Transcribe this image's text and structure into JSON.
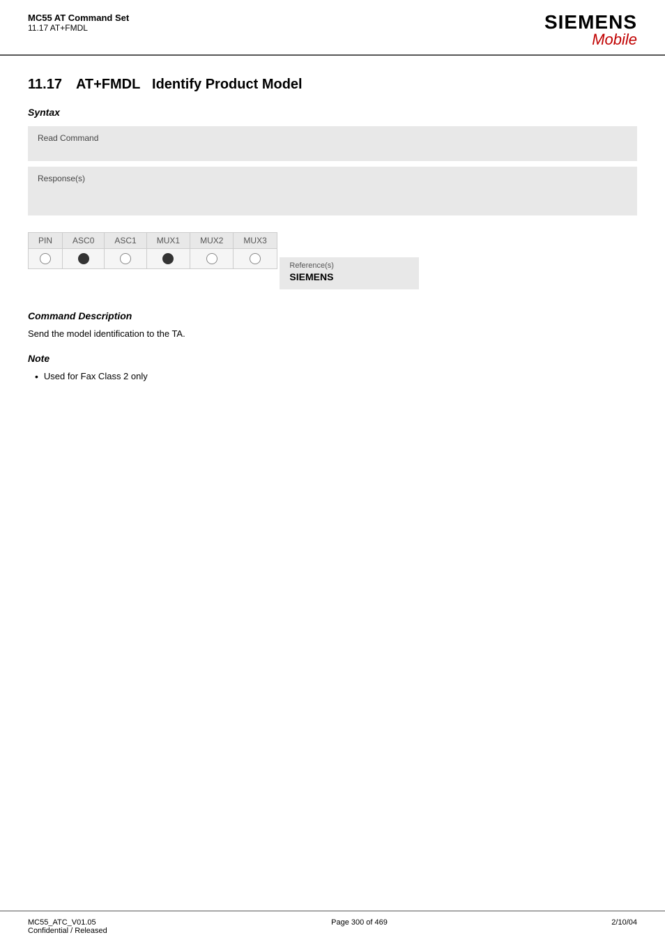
{
  "header": {
    "title": "MC55 AT Command Set",
    "subtitle": "11.17 AT+FMDL",
    "logo_main": "SIEMENS",
    "logo_sub": "Mobile"
  },
  "section": {
    "number": "11.17",
    "command": "AT+FMDL",
    "title": "Identify Product Model"
  },
  "syntax": {
    "label": "Syntax",
    "read_command_label": "Read Command",
    "read_command_value": "",
    "response_label": "Response(s)",
    "response_value": ""
  },
  "pin_table": {
    "headers": [
      "PIN",
      "ASC0",
      "ASC1",
      "MUX1",
      "MUX2",
      "MUX3"
    ],
    "rows": [
      [
        "empty",
        "filled",
        "empty",
        "filled",
        "empty",
        "empty"
      ]
    ]
  },
  "reference": {
    "label": "Reference(s)",
    "value": "SIEMENS"
  },
  "command_description": {
    "label": "Command Description",
    "text": "Send the model identification to the TA."
  },
  "note": {
    "label": "Note",
    "items": [
      "Used for Fax Class 2 only"
    ]
  },
  "footer": {
    "left_line1": "MC55_ATC_V01.05",
    "left_line2": "Confidential / Released",
    "center": "Page 300 of 469",
    "right": "2/10/04"
  }
}
